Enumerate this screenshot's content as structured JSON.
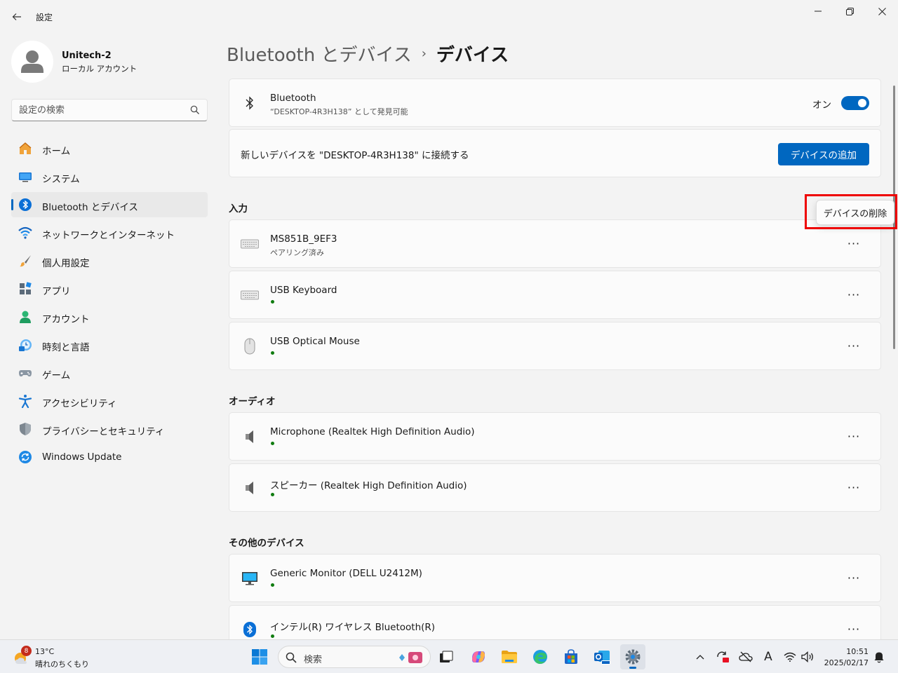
{
  "app": {
    "title": "設定"
  },
  "user": {
    "name": "Unitech-2",
    "account_type": "ローカル アカウント"
  },
  "search": {
    "placeholder": "設定の検索"
  },
  "nav": {
    "items": [
      {
        "label": "ホーム",
        "icon": "home-icon"
      },
      {
        "label": "システム",
        "icon": "system-icon"
      },
      {
        "label": "Bluetooth とデバイス",
        "icon": "bluetooth-icon",
        "active": true
      },
      {
        "label": "ネットワークとインターネット",
        "icon": "wifi-icon"
      },
      {
        "label": "個人用設定",
        "icon": "brush-icon"
      },
      {
        "label": "アプリ",
        "icon": "apps-icon"
      },
      {
        "label": "アカウント",
        "icon": "account-icon"
      },
      {
        "label": "時刻と言語",
        "icon": "time-language-icon"
      },
      {
        "label": "ゲーム",
        "icon": "gamepad-icon"
      },
      {
        "label": "アクセシビリティ",
        "icon": "accessibility-icon"
      },
      {
        "label": "プライバシーとセキュリティ",
        "icon": "shield-icon"
      },
      {
        "label": "Windows Update",
        "icon": "windows-update-icon"
      }
    ]
  },
  "breadcrumb": {
    "parent": "Bluetooth とデバイス",
    "separator": "›",
    "current": "デバイス"
  },
  "bluetooth": {
    "title": "Bluetooth",
    "subtitle": "“DESKTOP-4R3H138” として発見可能",
    "toggle_label": "オン",
    "toggle_on": true
  },
  "add_device": {
    "text": "新しいデバイスを \"DESKTOP-4R3H138\" に接続する",
    "button_label": "デバイスの追加"
  },
  "sections": {
    "input": {
      "title": "入力",
      "devices": [
        {
          "name": "MS851B_9EF3",
          "status": "ペアリング済み",
          "icon": "keyboard-icon"
        },
        {
          "name": "USB Keyboard",
          "status": "",
          "connected": true,
          "icon": "keyboard-icon"
        },
        {
          "name": "USB Optical Mouse",
          "status": "",
          "connected": true,
          "icon": "mouse-icon"
        }
      ]
    },
    "audio": {
      "title": "オーディオ",
      "devices": [
        {
          "name": "Microphone (Realtek High Definition Audio)",
          "connected": true,
          "icon": "speaker-icon"
        },
        {
          "name": "スピーカー (Realtek High Definition Audio)",
          "connected": true,
          "icon": "speaker-icon"
        }
      ]
    },
    "other": {
      "title": "その他のデバイス",
      "devices": [
        {
          "name": "Generic Monitor (DELL U2412M)",
          "connected": true,
          "icon": "monitor-icon"
        },
        {
          "name": "インテル(R) ワイヤレス Bluetooth(R)",
          "connected": true,
          "icon": "bluetooth-icon"
        }
      ]
    }
  },
  "context_menu": {
    "remove_label": "デバイスの削除"
  },
  "more_glyph": "···",
  "taskbar": {
    "weather": {
      "badge": "8",
      "temp": "13°C",
      "desc": "晴れのちくもり"
    },
    "search_label": "検索",
    "apps": [
      "start-icon",
      "search-icon",
      "task-view-icon",
      "copilot-icon",
      "file-explorer-icon",
      "edge-icon",
      "store-icon",
      "outlook-icon",
      "settings-icon"
    ],
    "tray": [
      "chevron-up-icon",
      "sync-icon",
      "cloud-off-icon",
      "ime-icon",
      "wifi-icon",
      "volume-icon"
    ],
    "ime_glyph": "A",
    "clock": {
      "time": "10:51",
      "date": "2025/02/17"
    }
  },
  "colors": {
    "accent": "#0067c0",
    "connected": "#107c10",
    "highlight": "#e00000",
    "background": "#f3f3f3",
    "card": "#fbfbfb"
  }
}
